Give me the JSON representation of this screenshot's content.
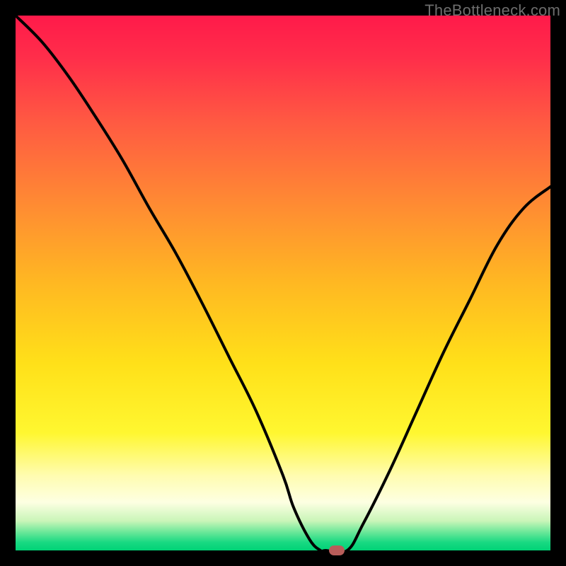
{
  "watermark": "TheBottleneck.com",
  "colors": {
    "gradient_stops": [
      {
        "offset": 0.0,
        "color": "#ff1a4a"
      },
      {
        "offset": 0.08,
        "color": "#ff2e4a"
      },
      {
        "offset": 0.2,
        "color": "#ff5a42"
      },
      {
        "offset": 0.35,
        "color": "#ff8a33"
      },
      {
        "offset": 0.5,
        "color": "#ffb822"
      },
      {
        "offset": 0.65,
        "color": "#ffe019"
      },
      {
        "offset": 0.78,
        "color": "#fff730"
      },
      {
        "offset": 0.86,
        "color": "#fffcb0"
      },
      {
        "offset": 0.91,
        "color": "#fdffe2"
      },
      {
        "offset": 0.945,
        "color": "#c9f5b8"
      },
      {
        "offset": 0.965,
        "color": "#6ee89a"
      },
      {
        "offset": 0.985,
        "color": "#18d982"
      },
      {
        "offset": 1.0,
        "color": "#00d276"
      }
    ],
    "curve_stroke": "#000000",
    "marker_fill": "#b85d5a",
    "frame": "#000000"
  },
  "chart_data": {
    "type": "line",
    "title": "",
    "xlabel": "",
    "ylabel": "",
    "xlim": [
      0,
      100
    ],
    "ylim": [
      0,
      100
    ],
    "grid": false,
    "legend": false,
    "y_direction": "down_is_better",
    "series": [
      {
        "name": "bottleneck-curve",
        "x": [
          0,
          5,
          10,
          15,
          20,
          25,
          30,
          35,
          40,
          45,
          50,
          52,
          55,
          57,
          58,
          62,
          65,
          70,
          75,
          80,
          85,
          90,
          95,
          100
        ],
        "y": [
          100,
          95,
          88.5,
          81,
          73,
          64,
          55.5,
          46,
          36,
          26,
          14,
          8,
          2,
          0,
          0,
          0,
          5,
          15,
          26,
          37,
          47,
          57,
          64,
          68
        ]
      }
    ],
    "marker": {
      "x": 60,
      "y": 0
    }
  }
}
